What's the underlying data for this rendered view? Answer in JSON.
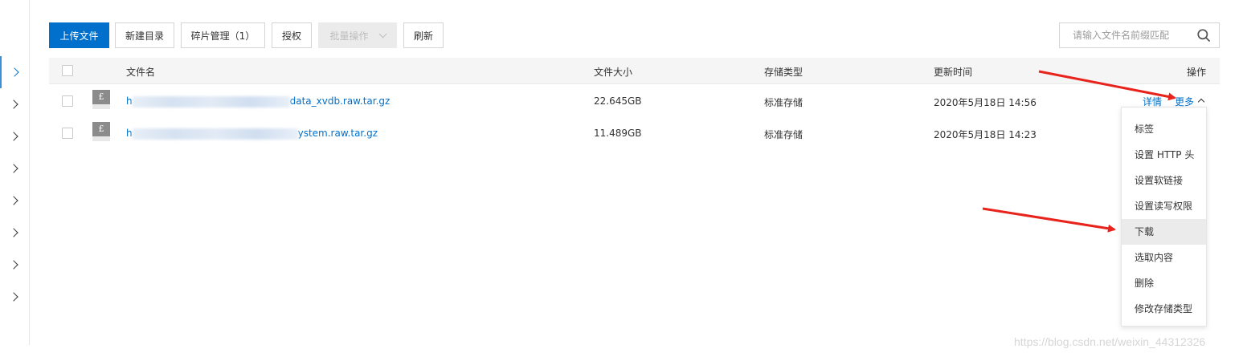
{
  "toolbar": {
    "upload": "上传文件",
    "new_dir": "新建目录",
    "fragments": "碎片管理（1）",
    "authorize": "授权",
    "batch": "批量操作",
    "refresh": "刷新"
  },
  "search": {
    "placeholder": "请输入文件名前缀匹配",
    "icon": "search-icon"
  },
  "table": {
    "headers": {
      "name": "文件名",
      "size": "文件大小",
      "storage": "存储类型",
      "updated": "更新时间",
      "ops": "操作"
    },
    "rows": [
      {
        "name_prefix": "h",
        "name_suffix": "data_xvdb.raw.tar.gz",
        "size": "22.645GB",
        "storage": "标准存储",
        "updated": "2020年5月18日 14:56",
        "detail": "详情",
        "more": "更多"
      },
      {
        "name_prefix": "h",
        "name_suffix": "ystem.raw.tar.gz",
        "size": "11.489GB",
        "storage": "标准存储",
        "updated": "2020年5月18日 14:23"
      }
    ]
  },
  "menu": {
    "items": [
      "标签",
      "设置 HTTP 头",
      "设置软链接",
      "设置读写权限",
      "下载",
      "选取内容",
      "删除",
      "修改存储类型"
    ],
    "highlighted": "下载"
  },
  "colors": {
    "primary": "#0070cc",
    "arrow": "#e8231b"
  },
  "watermark": "https://blog.csdn.net/weixin_44312326"
}
